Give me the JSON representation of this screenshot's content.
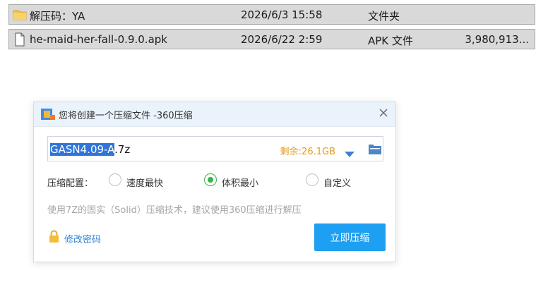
{
  "files": [
    {
      "name": "解压码：YA",
      "date": "2026/6/3 15:58",
      "type": "文件夹",
      "size": "",
      "icon": "folder-icon"
    },
    {
      "name": "he-maid-her-fall-0.9.0.apk",
      "date": "2026/6/22 2:59",
      "type": "APK 文件",
      "size": "3,980,913...",
      "icon": "file-icon"
    }
  ],
  "dialog": {
    "title": "您将创建一个压缩文件 -360压缩",
    "filename_selected": "GASN4.09-A",
    "filename_rest": ".7z",
    "remaining": "剩余:26.1GB",
    "config_label": "压缩配置：",
    "options": [
      {
        "label": "速度最快",
        "checked": false
      },
      {
        "label": "体积最小",
        "checked": true
      },
      {
        "label": "自定义",
        "checked": false
      }
    ],
    "hint": "使用7Z的固实（Solid）压缩技术，建议使用360压缩进行解压",
    "password_link": "修改密码",
    "compress_button": "立即压缩"
  },
  "colors": {
    "accent": "#1d9ff2",
    "remaining": "#e39a17",
    "radio_checked": "#38b44a",
    "link": "#2f7fd6"
  }
}
